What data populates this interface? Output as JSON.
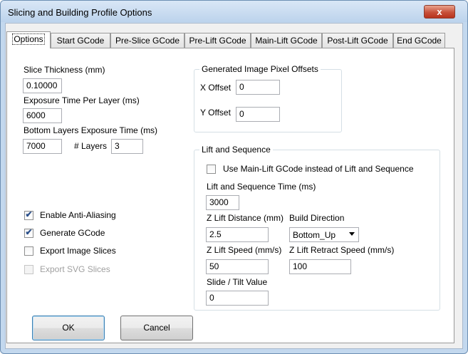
{
  "window": {
    "title": "Slicing and Building Profile Options",
    "close_glyph": "x"
  },
  "tabs": [
    {
      "label": "Options",
      "active": true
    },
    {
      "label": "Start GCode",
      "active": false
    },
    {
      "label": "Pre-Slice GCode",
      "active": false
    },
    {
      "label": "Pre-Lift GCode",
      "active": false
    },
    {
      "label": "Main-Lift GCode",
      "active": false
    },
    {
      "label": "Post-Lift GCode",
      "active": false
    },
    {
      "label": "End GCode",
      "active": false
    }
  ],
  "options": {
    "slice_thickness_label": "Slice Thickness (mm)",
    "slice_thickness_value": "0.10000",
    "exposure_time_label": "Exposure Time Per Layer (ms)",
    "exposure_time_value": "6000",
    "bottom_exposure_label": "Bottom Layers Exposure Time (ms)",
    "bottom_exposure_value": "7000",
    "layers_label": "# Layers",
    "layers_value": "3",
    "checkboxes": [
      {
        "label": "Enable Anti-Aliasing",
        "checked": true,
        "enabled": true
      },
      {
        "label": "Generate GCode",
        "checked": true,
        "enabled": true
      },
      {
        "label": "Export Image Slices",
        "checked": false,
        "enabled": true
      },
      {
        "label": "Export SVG Slices",
        "checked": false,
        "enabled": false
      }
    ]
  },
  "pixel_offsets": {
    "title": "Generated Image Pixel Offsets",
    "x_label": "X Offset",
    "x_value": "0",
    "y_label": "Y Offset",
    "y_value": "0"
  },
  "lift": {
    "title": "Lift and Sequence",
    "use_mainlift_label": "Use Main-Lift GCode instead of Lift and Sequence",
    "use_mainlift_checked": false,
    "seq_time_label": "Lift and Sequence Time (ms)",
    "seq_time_value": "3000",
    "z_lift_distance_label": "Z Lift Distance (mm)",
    "z_lift_distance_value": "2.5",
    "build_direction_label": "Build Direction",
    "build_direction_value": "Bottom_Up",
    "z_lift_speed_label": "Z Lift Speed (mm/s)",
    "z_lift_speed_value": "50",
    "z_retract_speed_label": "Z Lift Retract Speed (mm/s)",
    "z_retract_speed_value": "100",
    "slide_tilt_label": "Slide / Tilt Value",
    "slide_tilt_value": "0"
  },
  "buttons": {
    "ok": "OK",
    "cancel": "Cancel"
  },
  "colors": {
    "titlebar": "#c3d8ee",
    "close_button": "#c7503a",
    "check_mark": "#2a4f8a"
  },
  "icons": {
    "check": "✔"
  }
}
